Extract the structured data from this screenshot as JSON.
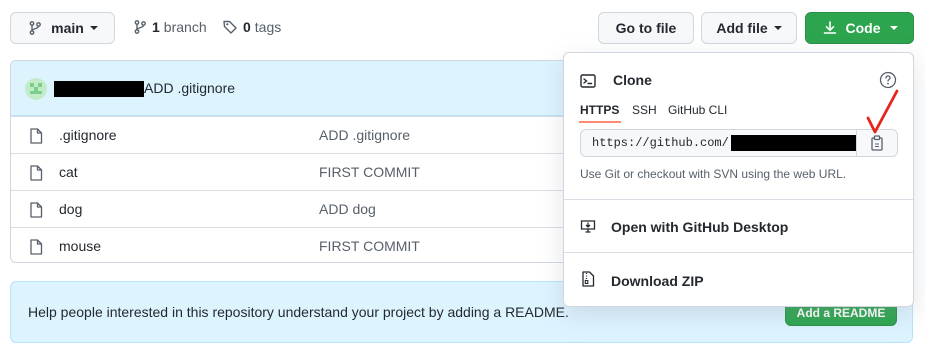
{
  "toolbar": {
    "branch_button": "main",
    "branch_count": "1",
    "branch_label": "branch",
    "tag_count": "0",
    "tag_label": "tags",
    "go_to_file": "Go to file",
    "add_file": "Add file",
    "code": "Code"
  },
  "commit": {
    "message": "ADD .gitignore"
  },
  "files": [
    {
      "name": ".gitignore",
      "message": "ADD .gitignore"
    },
    {
      "name": "cat",
      "message": "FIRST COMMIT"
    },
    {
      "name": "dog",
      "message": "ADD dog"
    },
    {
      "name": "mouse",
      "message": "FIRST COMMIT"
    }
  ],
  "readme": {
    "text": "Help people interested in this repository understand your project by adding a README.",
    "button": "Add a README"
  },
  "clone": {
    "title": "Clone",
    "tabs": [
      "HTTPS",
      "SSH",
      "GitHub CLI"
    ],
    "active_tab": "HTTPS",
    "url_prefix": "https://github.com/",
    "hint": "Use Git or checkout with SVN using the web URL.",
    "open_desktop": "Open with GitHub Desktop",
    "download_zip": "Download ZIP"
  },
  "colors": {
    "green": "#2da44e",
    "accent_tab": "#fd8c73",
    "annotation_mark": "#e5261e",
    "banner_bg": "#ddf4ff"
  },
  "icons": [
    "git-branch-icon",
    "tag-icon",
    "download-icon",
    "file-icon",
    "terminal-icon",
    "help-icon",
    "clipboard-icon",
    "desktop-download-icon",
    "file-zip-icon",
    "avatar"
  ]
}
